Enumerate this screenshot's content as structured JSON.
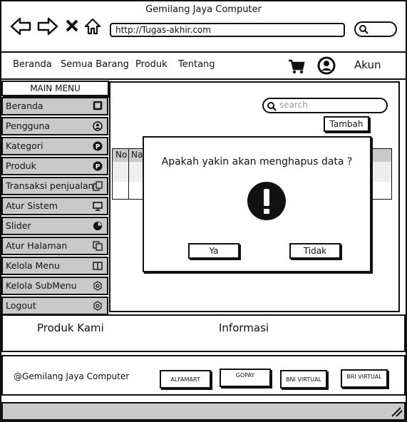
{
  "browser": {
    "title": "Gemilang Jaya Computer",
    "url": "http://Tugas-akhir.com"
  },
  "navbar": {
    "links": [
      "Beranda",
      "Semua Barang",
      "Produk",
      "Tentang"
    ],
    "account": "Akun"
  },
  "sidebar": {
    "header": "MAIN MENU",
    "items": [
      {
        "label": "Beranda",
        "icon": "square-icon"
      },
      {
        "label": "Pengguna",
        "icon": "user-icon"
      },
      {
        "label": "Kategori",
        "icon": "p-circle-icon"
      },
      {
        "label": "Produk",
        "icon": "p-circle-icon"
      },
      {
        "label": "Transaksi penjualan",
        "icon": "copy-icon"
      },
      {
        "label": "Atur Sistem",
        "icon": "monitor-icon"
      },
      {
        "label": "Slider",
        "icon": "pie-icon"
      },
      {
        "label": "Atur Halaman",
        "icon": "pages-icon"
      },
      {
        "label": "Kelola Menu",
        "icon": "book-icon"
      },
      {
        "label": "Kelola SubMenu",
        "icon": "gear-icon"
      },
      {
        "label": "Logout",
        "icon": "gear-icon"
      }
    ]
  },
  "main": {
    "search_placeholder": "search",
    "add_button": "Tambah",
    "table_headers": [
      "No",
      "Na"
    ]
  },
  "dialog": {
    "message": "Apakah yakin akan menghapus data ?",
    "yes": "Ya",
    "no": "Tidak"
  },
  "footer": {
    "col1": "Produk Kami",
    "col2": "Informasi",
    "copyright": "@Gemilang Jaya Computer",
    "payments": [
      "ALFAMART",
      "GOPAY",
      "BNI VIRTUAL",
      "BRI VIRTUAL"
    ]
  }
}
